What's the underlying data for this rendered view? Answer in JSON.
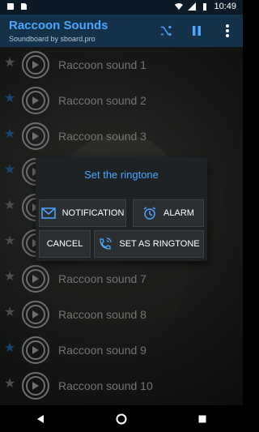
{
  "status": {
    "time": "10:49"
  },
  "app": {
    "title": "Raccoon Sounds",
    "subtitle": "Soundboard by sboard.pro"
  },
  "toolbar": {
    "icons": [
      "shuffle-icon",
      "pause-icon",
      "more-vert-icon"
    ]
  },
  "sounds": [
    {
      "label": "Raccoon sound 1",
      "favorite": false
    },
    {
      "label": "Raccoon sound 2",
      "favorite": true
    },
    {
      "label": "Raccoon sound 3",
      "favorite": true
    },
    {
      "label": "",
      "favorite": true
    },
    {
      "label": "",
      "favorite": false
    },
    {
      "label": "",
      "favorite": false
    },
    {
      "label": "Raccoon sound 7",
      "favorite": false
    },
    {
      "label": "Raccoon sound 8",
      "favorite": false
    },
    {
      "label": "Raccoon sound 9",
      "favorite": true
    },
    {
      "label": "Raccoon sound 10",
      "favorite": false
    }
  ],
  "dialog": {
    "title": "Set the ringtone",
    "notification_label": "NOTIFICATION",
    "alarm_label": "ALARM",
    "cancel_label": "CANCEL",
    "set_ringtone_label": "SET AS RINGTONE"
  },
  "colors": {
    "accent": "#4aa6ff",
    "appbar": "#13324a",
    "star_on": "#2f7ed1"
  }
}
